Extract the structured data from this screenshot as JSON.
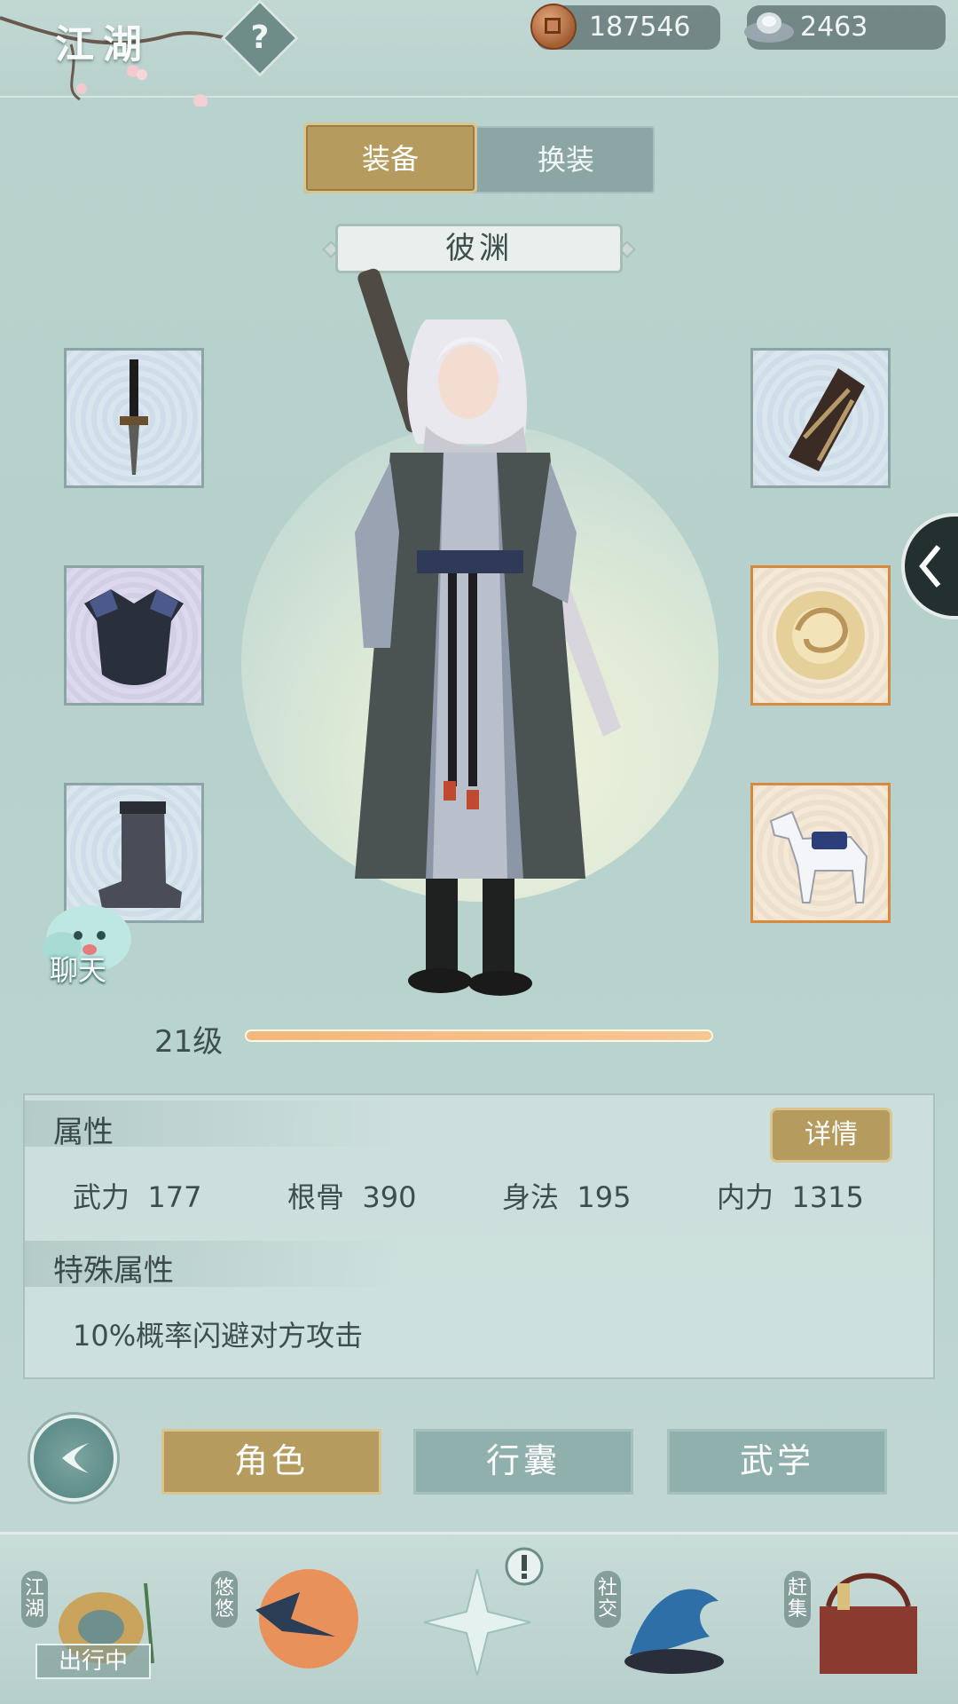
{
  "header": {
    "title": "江湖",
    "help_symbol": "?"
  },
  "currencies": [
    {
      "name": "copper-coin",
      "value": "187546"
    },
    {
      "name": "silver-ingot",
      "value": "2463"
    }
  ],
  "tabs": [
    {
      "label": "装备",
      "active": true
    },
    {
      "label": "换装",
      "active": false
    }
  ],
  "character": {
    "name": "彼渊",
    "level": "21级",
    "xp_fraction": 1.0
  },
  "equipment": {
    "left": [
      "weapon",
      "armor",
      "boots"
    ],
    "right": [
      "bracer",
      "jade-pendant",
      "horse"
    ]
  },
  "chat": {
    "label": "聊天"
  },
  "attributes": {
    "title": "属性",
    "details_label": "详情",
    "stats": [
      {
        "name": "武力",
        "value": "177"
      },
      {
        "name": "根骨",
        "value": "390"
      },
      {
        "name": "身法",
        "value": "195"
      },
      {
        "name": "内力",
        "value": "1315"
      }
    ],
    "special_title": "特殊属性",
    "special_text": "10%概率闪避对方攻击"
  },
  "nav": [
    {
      "label": "角色",
      "active": true
    },
    {
      "label": "行囊",
      "active": false
    },
    {
      "label": "武学",
      "active": false
    }
  ],
  "dock": [
    {
      "label": "江湖",
      "status": "出行中"
    },
    {
      "label": "悠悠"
    },
    {
      "label": ""
    },
    {
      "label": "社交"
    },
    {
      "label": "赶集"
    }
  ],
  "colors": {
    "gold_button": "#b69b5e",
    "teal_button": "#8fb0ad",
    "xp_fill": "#f2b77c"
  }
}
